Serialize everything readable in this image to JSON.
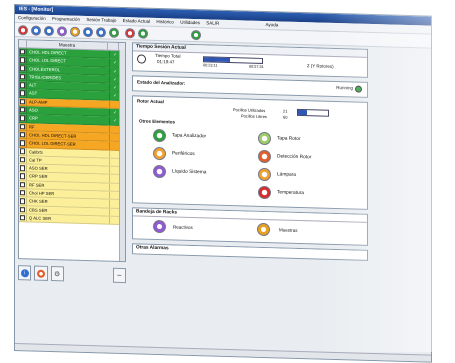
{
  "app": {
    "title": "IES - [Monitor]"
  },
  "menu": [
    "Configuración",
    "Programación",
    "Sesión Trabajo",
    "Estado Actual",
    "Histórico",
    "Utilidades",
    "SALIR",
    "Ayuda"
  ],
  "list": {
    "header": "Muestra",
    "rows": [
      {
        "name": "CHOL HDL DIRECT",
        "checked": true,
        "color": "g"
      },
      {
        "name": "CHOL LDL DIRECT",
        "checked": true,
        "color": "g"
      },
      {
        "name": "CHOLESTEROL",
        "checked": true,
        "color": "g"
      },
      {
        "name": "TRIGLICERIDES",
        "checked": true,
        "color": "g"
      },
      {
        "name": "ALT",
        "checked": true,
        "color": "g"
      },
      {
        "name": "AST",
        "checked": true,
        "color": "g"
      },
      {
        "name": "ALP-AMP",
        "checked": false,
        "color": "o"
      },
      {
        "name": "ASO",
        "checked": true,
        "color": "g"
      },
      {
        "name": "CRP",
        "checked": true,
        "color": "g"
      },
      {
        "name": "RF",
        "checked": false,
        "color": "o"
      },
      {
        "name": "CHOL HDL DIRECT-SER",
        "checked": false,
        "color": "o"
      },
      {
        "name": "CHOL LDL DIRECT-SER",
        "checked": false,
        "color": "o"
      },
      {
        "name": "CalibrS",
        "checked": false,
        "color": "y"
      },
      {
        "name": "Cal TP",
        "checked": false,
        "color": "y"
      },
      {
        "name": "ASO SER",
        "checked": false,
        "color": "y"
      },
      {
        "name": "CRP SER",
        "checked": false,
        "color": "y"
      },
      {
        "name": "RF SER",
        "checked": false,
        "color": "y"
      },
      {
        "name": "Chol HP SER",
        "checked": false,
        "color": "y"
      },
      {
        "name": "CHK SER",
        "checked": false,
        "color": "y"
      },
      {
        "name": "CBS SER",
        "checked": false,
        "color": "y"
      },
      {
        "name": "Q ALC SER",
        "checked": false,
        "color": "y"
      }
    ]
  },
  "check_mark": "✓",
  "sesion": {
    "title": "Tiempo Sesión Actual",
    "label": "Tiempo Total",
    "elapsed": "01:19:47",
    "start": "00:23:11",
    "end": "00:57:31",
    "progress": 0.45,
    "rotors": "2 (Y Rotores)"
  },
  "analizador": {
    "title": "Estado del Analizador:",
    "status": "Running"
  },
  "rotor": {
    "title": "Rotor Actual",
    "utilizados_label": "Pocillos Utilizados",
    "utilizados": "21",
    "libres_label": "Pocillos Libres",
    "libres": "60",
    "fill": 0.3
  },
  "otros": {
    "title": "Otros Elementos",
    "items": [
      {
        "label": "Tapa Analizador",
        "icon": "lid-icon",
        "color": "#2aa13c"
      },
      {
        "label": "Tapa Rotor",
        "icon": "rotor-lid-icon",
        "color": "#9ccc65"
      },
      {
        "label": "Periféricos",
        "icon": "peripherals-icon",
        "color": "#f0a030"
      },
      {
        "label": "Detección Rotor",
        "icon": "rotor-detect-icon",
        "color": "#e35d2a"
      },
      {
        "label": "Líquido Sistema",
        "icon": "liquid-icon",
        "color": "#8e5bd0"
      },
      {
        "label": "Lámpara",
        "icon": "lamp-icon",
        "color": "#f0a030"
      },
      {
        "label": "",
        "icon": "",
        "color": ""
      },
      {
        "label": "Temperatura",
        "icon": "temperature-icon",
        "color": "#d92b2b"
      }
    ]
  },
  "bandeja": {
    "title": "Bandeja de Racks",
    "reactivos": "Reactivos",
    "muestras": "Muestras"
  },
  "alarmas": {
    "title": "Otras Alarmas"
  }
}
